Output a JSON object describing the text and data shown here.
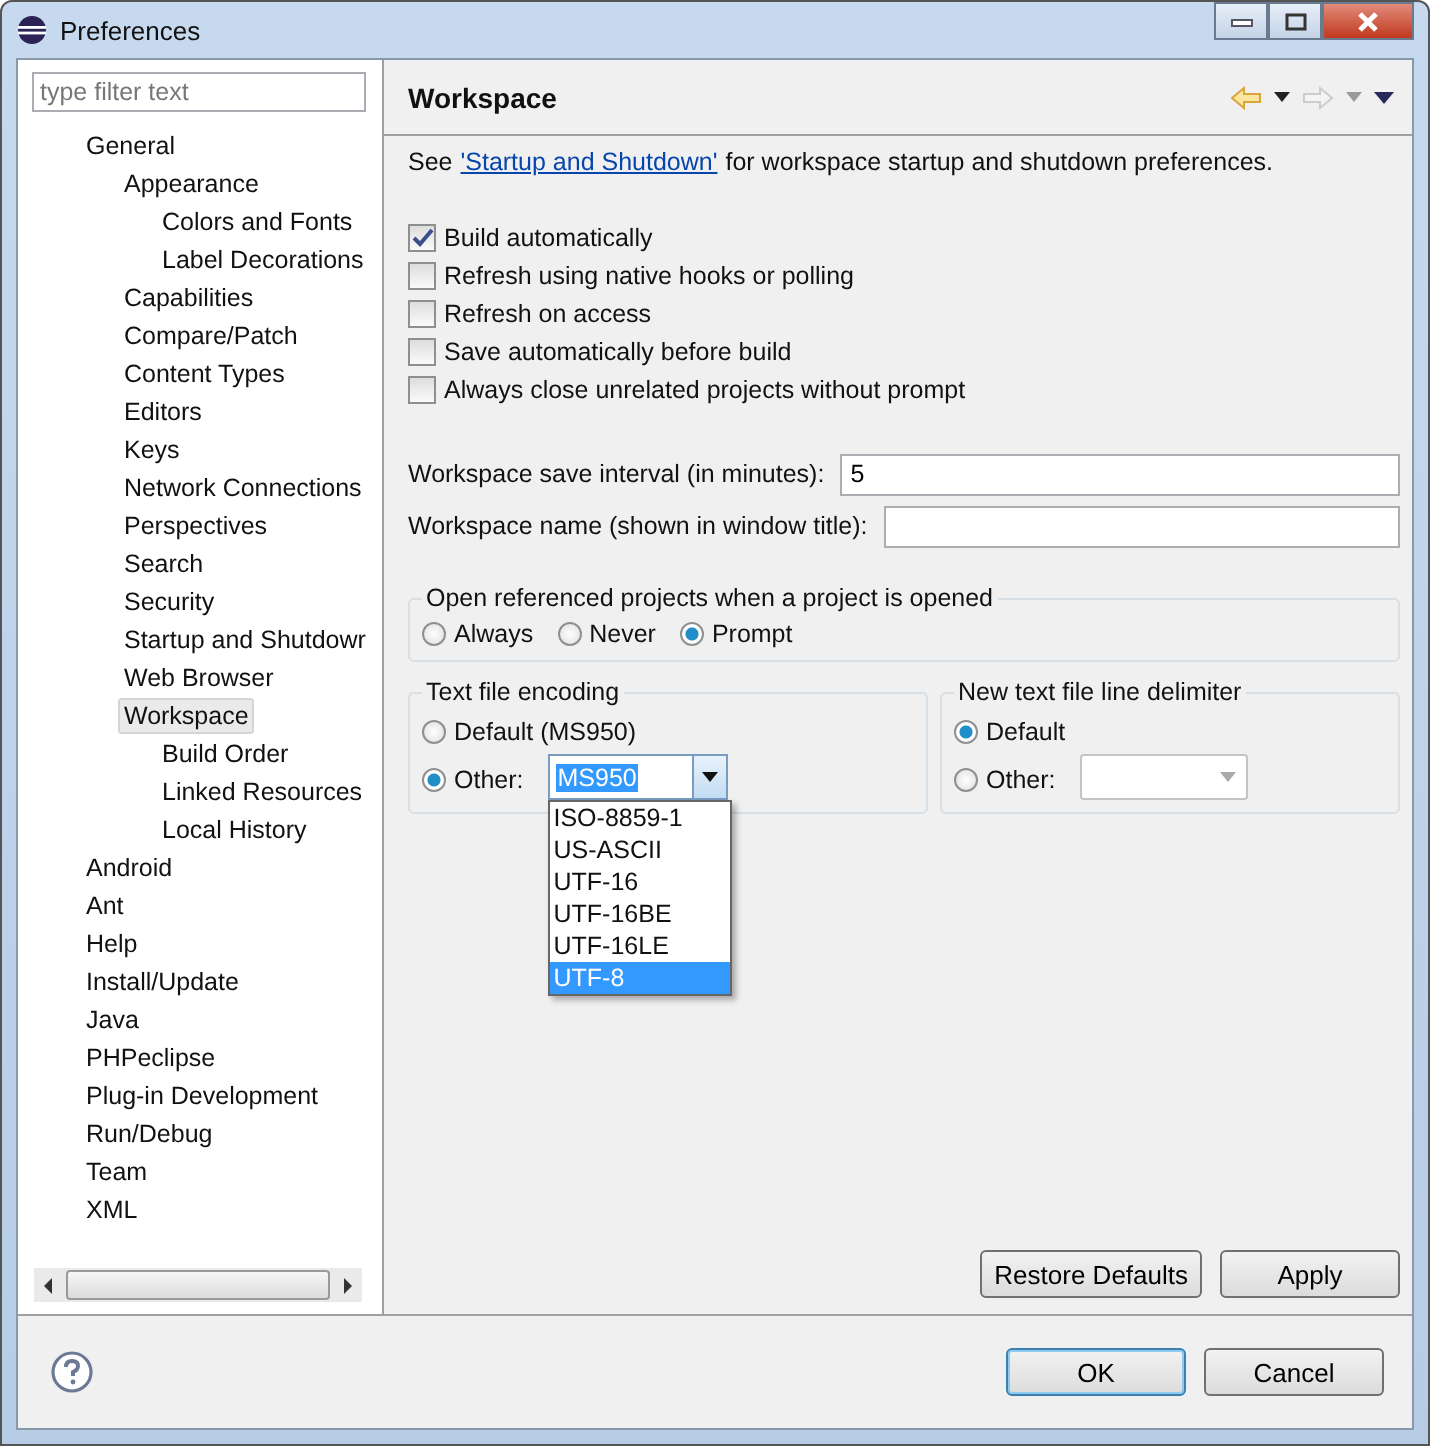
{
  "window": {
    "title": "Preferences"
  },
  "filter": {
    "placeholder": "type filter text"
  },
  "tree": [
    {
      "label": "General",
      "selected": false,
      "children": [
        {
          "label": "Appearance",
          "selected": false,
          "children": [
            {
              "label": "Colors and Fonts",
              "selected": false
            },
            {
              "label": "Label Decorations",
              "selected": false
            }
          ]
        },
        {
          "label": "Capabilities",
          "selected": false
        },
        {
          "label": "Compare/Patch",
          "selected": false
        },
        {
          "label": "Content Types",
          "selected": false
        },
        {
          "label": "Editors",
          "selected": false
        },
        {
          "label": "Keys",
          "selected": false
        },
        {
          "label": "Network Connections",
          "selected": false
        },
        {
          "label": "Perspectives",
          "selected": false
        },
        {
          "label": "Search",
          "selected": false
        },
        {
          "label": "Security",
          "selected": false
        },
        {
          "label": "Startup and Shutdowr",
          "selected": false
        },
        {
          "label": "Web Browser",
          "selected": false
        },
        {
          "label": "Workspace",
          "selected": true,
          "children": [
            {
              "label": "Build Order",
              "selected": false
            },
            {
              "label": "Linked Resources",
              "selected": false
            },
            {
              "label": "Local History",
              "selected": false
            }
          ]
        }
      ]
    },
    {
      "label": "Android",
      "selected": false
    },
    {
      "label": "Ant",
      "selected": false
    },
    {
      "label": "Help",
      "selected": false
    },
    {
      "label": "Install/Update",
      "selected": false
    },
    {
      "label": "Java",
      "selected": false
    },
    {
      "label": "PHPeclipse",
      "selected": false
    },
    {
      "label": "Plug-in Development",
      "selected": false
    },
    {
      "label": "Run/Debug",
      "selected": false
    },
    {
      "label": "Team",
      "selected": false
    },
    {
      "label": "XML",
      "selected": false
    }
  ],
  "page": {
    "title": "Workspace",
    "intro_before": "See",
    "intro_link": "'Startup and Shutdown'",
    "intro_after": "for workspace startup and shutdown preferences."
  },
  "checkboxes": [
    {
      "label": "Build automatically",
      "checked": true
    },
    {
      "label": "Refresh using native hooks or polling",
      "checked": false
    },
    {
      "label": "Refresh on access",
      "checked": false
    },
    {
      "label": "Save automatically before build",
      "checked": false
    },
    {
      "label": "Always close unrelated projects without prompt",
      "checked": false
    }
  ],
  "save_interval": {
    "label": "Workspace save interval (in minutes):",
    "value": "5"
  },
  "workspace_name": {
    "label": "Workspace name (shown in window title):"
  },
  "open_projects": {
    "title": "Open referenced projects when a project is opened",
    "options": [
      {
        "label": "Always",
        "selected": false
      },
      {
        "label": "Never",
        "selected": false
      },
      {
        "label": "Prompt",
        "selected": true
      }
    ]
  },
  "encoding": {
    "title": "Text file encoding",
    "default_label": "Default (MS950)",
    "default_selected": false,
    "other_label": "Other:",
    "other_selected": true,
    "value": "MS950",
    "dropdown": [
      {
        "label": "ISO-8859-1",
        "selected": false
      },
      {
        "label": "US-ASCII",
        "selected": false
      },
      {
        "label": "UTF-16",
        "selected": false
      },
      {
        "label": "UTF-16BE",
        "selected": false
      },
      {
        "label": "UTF-16LE",
        "selected": false
      },
      {
        "label": "UTF-8",
        "selected": true
      }
    ]
  },
  "delimiter": {
    "title": "New text file line delimiter",
    "default_label": "Default",
    "default_selected": true,
    "other_label": "Other:",
    "other_selected": false
  },
  "page_buttons": [
    "Restore Defaults",
    "Apply"
  ],
  "dialog_buttons": [
    {
      "label": "OK",
      "default": true
    },
    {
      "label": "Cancel",
      "default": false
    }
  ]
}
